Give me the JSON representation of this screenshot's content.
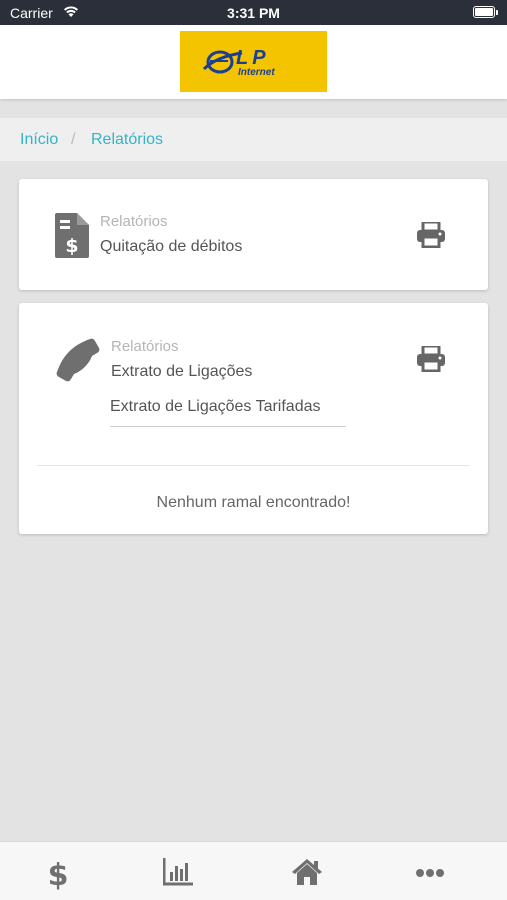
{
  "status_bar": {
    "carrier": "Carrier",
    "time": "3:31 PM"
  },
  "logo": {
    "brand": "LP",
    "sub": "Internet",
    "bg_color": "#f5c400"
  },
  "breadcrumb": {
    "home": "Início",
    "separator": "/",
    "current": "Relatórios",
    "link_color": "#35b3c8"
  },
  "cards": [
    {
      "icon": "invoice-dollar-icon",
      "category": "Relatórios",
      "title": "Quitação de débitos",
      "action_icon": "print-icon"
    },
    {
      "icon": "phone-icon",
      "category": "Relatórios",
      "title": "Extrato de Ligações",
      "action_icon": "print-icon",
      "select_value": "Extrato de Ligações Tarifadas",
      "empty_message": "Nenhum ramal encontrado!"
    }
  ],
  "tabbar": {
    "items": [
      "dollar-icon",
      "bar-chart-icon",
      "home-icon",
      "more-icon"
    ]
  }
}
